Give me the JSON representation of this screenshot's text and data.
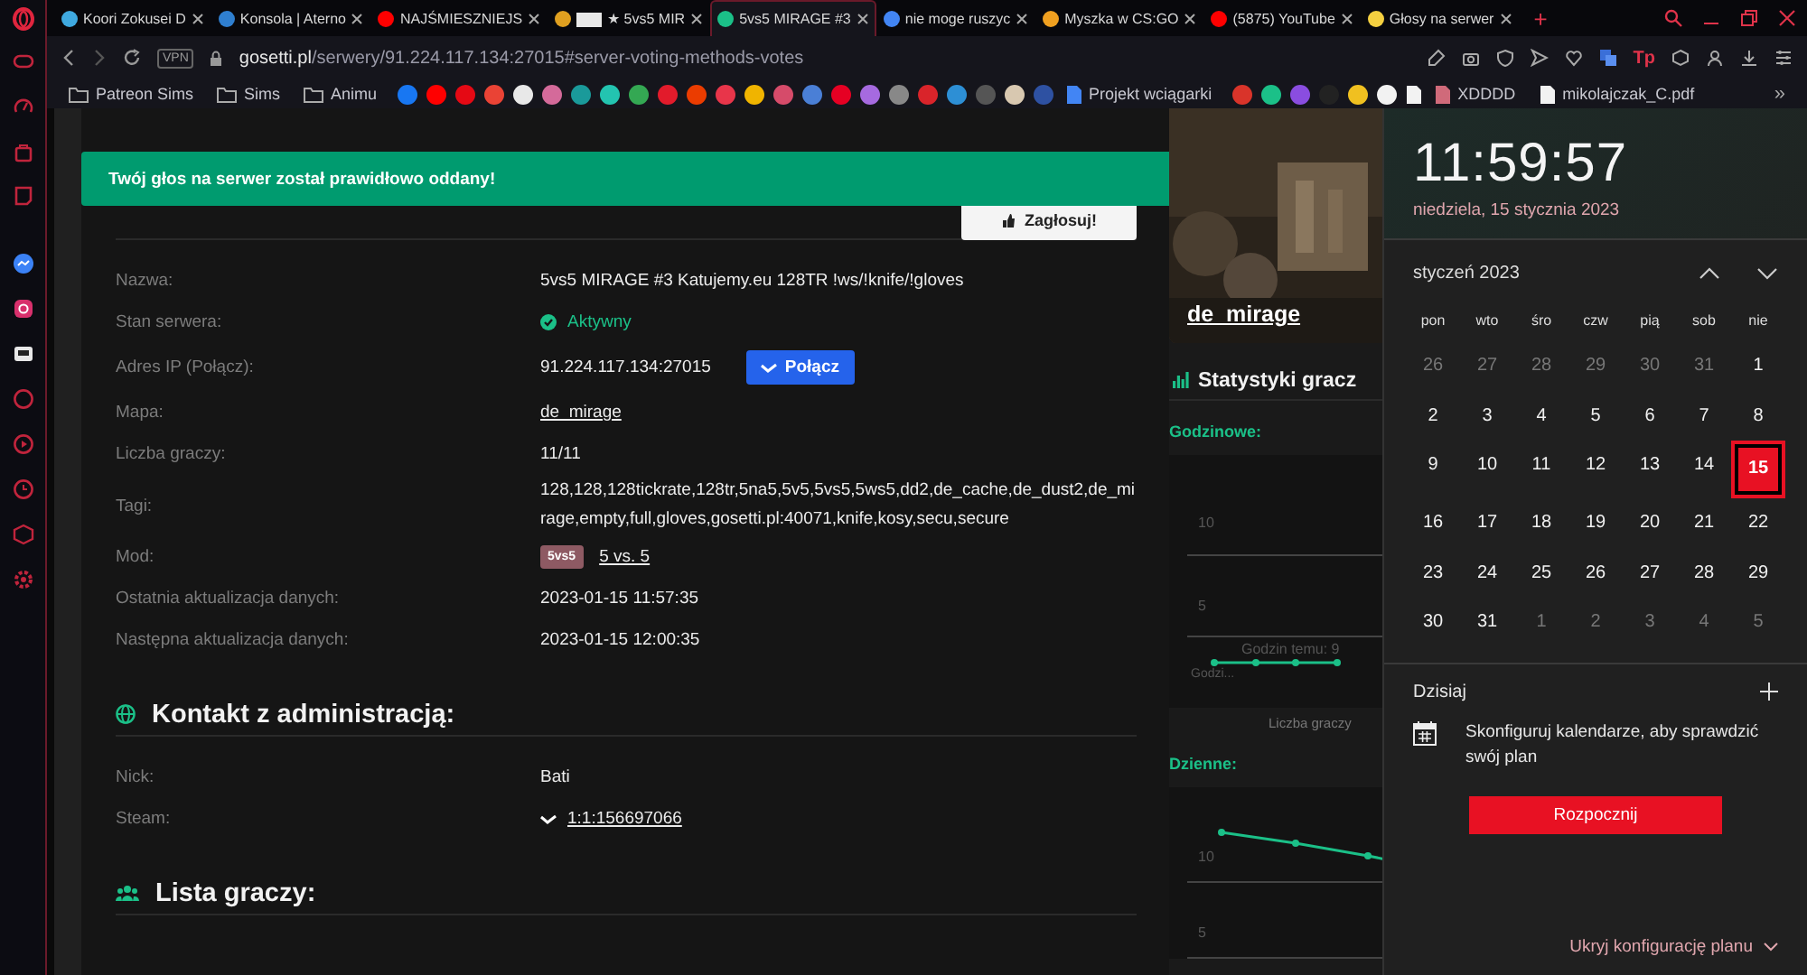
{
  "browser": {
    "tabs": [
      {
        "title": "Koori Zokusei D",
        "color": "#3fa9e0",
        "selected": false,
        "redacted": false
      },
      {
        "title": "Konsola | Aterno",
        "color": "#2f7fd0",
        "selected": false,
        "redacted": false
      },
      {
        "title": "NAJŚMIESZNIEJS",
        "color": "#ff0000",
        "selected": false,
        "redacted": false
      },
      {
        "title": "★ 5vs5 MIR",
        "color": "#e0a020",
        "selected": false,
        "redacted": true
      },
      {
        "title": "5vs5 MIRAGE #3",
        "color": "#1bc088",
        "selected": true,
        "redacted": false
      },
      {
        "title": "nie moge ruszyc",
        "color": "#4285f4",
        "selected": false,
        "redacted": false
      },
      {
        "title": "Myszka w CS:GO",
        "color": "#f0a020",
        "selected": false,
        "redacted": false
      },
      {
        "title": "(5875) YouTube",
        "color": "#ff0000",
        "selected": false,
        "redacted": false
      },
      {
        "title": "Głosy na serwer",
        "color": "#f5d040",
        "selected": false,
        "redacted": false
      }
    ],
    "new_tab": "+",
    "vpn": "VPN",
    "address": {
      "domain": "gosetti.pl",
      "path": "/serwery/91.224.117.134:27015#server-voting-methods-votes"
    },
    "toolbar_badge": "Tp",
    "bookmarks": [
      {
        "kind": "folder",
        "label": "Patreon Sims"
      },
      {
        "kind": "folder",
        "label": "Sims"
      },
      {
        "kind": "folder",
        "label": "Animu"
      },
      {
        "kind": "site",
        "color": "#1877f2"
      },
      {
        "kind": "site",
        "color": "#ff0000"
      },
      {
        "kind": "site",
        "color": "#e50914"
      },
      {
        "kind": "site",
        "color": "#ea4335"
      },
      {
        "kind": "site",
        "color": "#e8e8e8"
      },
      {
        "kind": "site",
        "color": "#d46a9a"
      },
      {
        "kind": "site",
        "color": "#1a9a9a"
      },
      {
        "kind": "site",
        "color": "#23c4b0"
      },
      {
        "kind": "site",
        "color": "#34a853"
      },
      {
        "kind": "site",
        "color": "#e21b2b"
      },
      {
        "kind": "site",
        "color": "#eb3c00"
      },
      {
        "kind": "site",
        "color": "#e8354a"
      },
      {
        "kind": "site",
        "color": "#f0b400"
      },
      {
        "kind": "site",
        "color": "#d64b6a"
      },
      {
        "kind": "site",
        "color": "#4a7fd6"
      },
      {
        "kind": "site",
        "color": "#e60023"
      },
      {
        "kind": "site",
        "color": "#a66ae0"
      },
      {
        "kind": "site",
        "color": "#888888"
      },
      {
        "kind": "site",
        "color": "#d9242a"
      },
      {
        "kind": "site",
        "color": "#2d8fd5"
      },
      {
        "kind": "site",
        "color": "#555555"
      },
      {
        "kind": "site",
        "color": "#d8c8b0"
      },
      {
        "kind": "site",
        "color": "#2e51a2"
      },
      {
        "kind": "doc",
        "color": "#4285f4",
        "label": "Projekt wciągarki"
      },
      {
        "kind": "site",
        "color": "#d9342a"
      },
      {
        "kind": "site",
        "color": "#1bc088"
      },
      {
        "kind": "site",
        "color": "#8a4de0"
      },
      {
        "kind": "site",
        "color": "#222222"
      },
      {
        "kind": "site",
        "color": "#f0c020"
      },
      {
        "kind": "site",
        "color": "#f2f2f2"
      },
      {
        "kind": "doc",
        "color": "#f2f2f2"
      },
      {
        "kind": "doc",
        "color": "#d06a7a",
        "label": "XDDDD"
      },
      {
        "kind": "doc",
        "color": "#f2f2f2",
        "label": "mikolajczak_C.pdf"
      }
    ],
    "more": "»"
  },
  "toast": "Twój głos na serwer został prawidłowo oddany!",
  "vote_button": "Zagłosuj!",
  "server_info": [
    {
      "kind": "text",
      "label": "Nazwa:",
      "value": "5vs5 MIRAGE #3 Katujemy.eu 128TR !ws/!knife/!gloves"
    },
    {
      "kind": "status",
      "label": "Stan serwera:",
      "value": "Aktywny"
    },
    {
      "kind": "ip",
      "label": "Adres IP (Połącz):",
      "value": "91.224.117.134:27015",
      "button": "Połącz"
    },
    {
      "kind": "link",
      "label": "Mapa:",
      "value": "de_mirage"
    },
    {
      "kind": "text",
      "label": "Liczba graczy:",
      "value": "11/11"
    },
    {
      "kind": "text",
      "label": "Tagi:",
      "value": "128,128,128tickrate,128tr,5na5,5v5,5vs5,5ws5,dd2,de_cache,de_dust2,de_mirage,empty,full,gloves,gosetti.pl:40071,knife,kosy,secu,secure"
    },
    {
      "kind": "mod",
      "label": "Mod:",
      "badge": "5vs5",
      "value": "5 vs. 5"
    },
    {
      "kind": "text",
      "label": "Ostatnia aktualizacja danych:",
      "value": "2023-01-15 11:57:35"
    },
    {
      "kind": "text",
      "label": "Następna aktualizacja danych:",
      "value": "2023-01-15 12:00:35"
    }
  ],
  "contact": {
    "title": "Kontakt z administracją:",
    "rows": [
      {
        "kind": "text",
        "label": "Nick:",
        "value": "Bati"
      },
      {
        "kind": "steam",
        "label": "Steam:",
        "value": "1:1:156697066"
      }
    ]
  },
  "players": {
    "title": "Lista graczy:"
  },
  "map": {
    "name": "de_mirage"
  },
  "stats": {
    "title": "Statystyki gracz",
    "hourly": {
      "title": "Godzinowe:",
      "ticks": [
        "10",
        "5"
      ],
      "tooltip": "Godzin temu: 9",
      "x_label": "Godzi...",
      "legend": "Liczba graczy"
    },
    "daily": {
      "title": "Dzienne:",
      "ticks": [
        "10",
        "5"
      ]
    }
  },
  "clock": {
    "time": "11:59:57",
    "date": "niedziela, 15 stycznia 2023",
    "month": "styczeń 2023",
    "weekdays": [
      "pon",
      "wto",
      "śro",
      "czw",
      "pią",
      "sob",
      "nie"
    ],
    "days": [
      {
        "day": "26",
        "current_month": false,
        "selected": false
      },
      {
        "day": "27",
        "current_month": false,
        "selected": false
      },
      {
        "day": "28",
        "current_month": false,
        "selected": false
      },
      {
        "day": "29",
        "current_month": false,
        "selected": false
      },
      {
        "day": "30",
        "current_month": false,
        "selected": false
      },
      {
        "day": "31",
        "current_month": false,
        "selected": false
      },
      {
        "day": "1",
        "current_month": true,
        "selected": false
      },
      {
        "day": "2",
        "current_month": true,
        "selected": false
      },
      {
        "day": "3",
        "current_month": true,
        "selected": false
      },
      {
        "day": "4",
        "current_month": true,
        "selected": false
      },
      {
        "day": "5",
        "current_month": true,
        "selected": false
      },
      {
        "day": "6",
        "current_month": true,
        "selected": false
      },
      {
        "day": "7",
        "current_month": true,
        "selected": false
      },
      {
        "day": "8",
        "current_month": true,
        "selected": false
      },
      {
        "day": "9",
        "current_month": true,
        "selected": false
      },
      {
        "day": "10",
        "current_month": true,
        "selected": false
      },
      {
        "day": "11",
        "current_month": true,
        "selected": false
      },
      {
        "day": "12",
        "current_month": true,
        "selected": false
      },
      {
        "day": "13",
        "current_month": true,
        "selected": false
      },
      {
        "day": "14",
        "current_month": true,
        "selected": false
      },
      {
        "day": "15",
        "current_month": true,
        "selected": true
      },
      {
        "day": "16",
        "current_month": true,
        "selected": false
      },
      {
        "day": "17",
        "current_month": true,
        "selected": false
      },
      {
        "day": "18",
        "current_month": true,
        "selected": false
      },
      {
        "day": "19",
        "current_month": true,
        "selected": false
      },
      {
        "day": "20",
        "current_month": true,
        "selected": false
      },
      {
        "day": "21",
        "current_month": true,
        "selected": false
      },
      {
        "day": "22",
        "current_month": true,
        "selected": false
      },
      {
        "day": "23",
        "current_month": true,
        "selected": false
      },
      {
        "day": "24",
        "current_month": true,
        "selected": false
      },
      {
        "day": "25",
        "current_month": true,
        "selected": false
      },
      {
        "day": "26",
        "current_month": true,
        "selected": false
      },
      {
        "day": "27",
        "current_month": true,
        "selected": false
      },
      {
        "day": "28",
        "current_month": true,
        "selected": false
      },
      {
        "day": "29",
        "current_month": true,
        "selected": false
      },
      {
        "day": "30",
        "current_month": true,
        "selected": false
      },
      {
        "day": "31",
        "current_month": true,
        "selected": false
      },
      {
        "day": "1",
        "current_month": false,
        "selected": false
      },
      {
        "day": "2",
        "current_month": false,
        "selected": false
      },
      {
        "day": "3",
        "current_month": false,
        "selected": false
      },
      {
        "day": "4",
        "current_month": false,
        "selected": false
      },
      {
        "day": "5",
        "current_month": false,
        "selected": false
      }
    ],
    "agenda_title": "Dzisiaj",
    "agenda_message": "Skonfiguruj kalendarze, aby sprawdzić swój plan",
    "start_button": "Rozpocznij",
    "hide_link": "Ukryj konfigurację planu"
  }
}
